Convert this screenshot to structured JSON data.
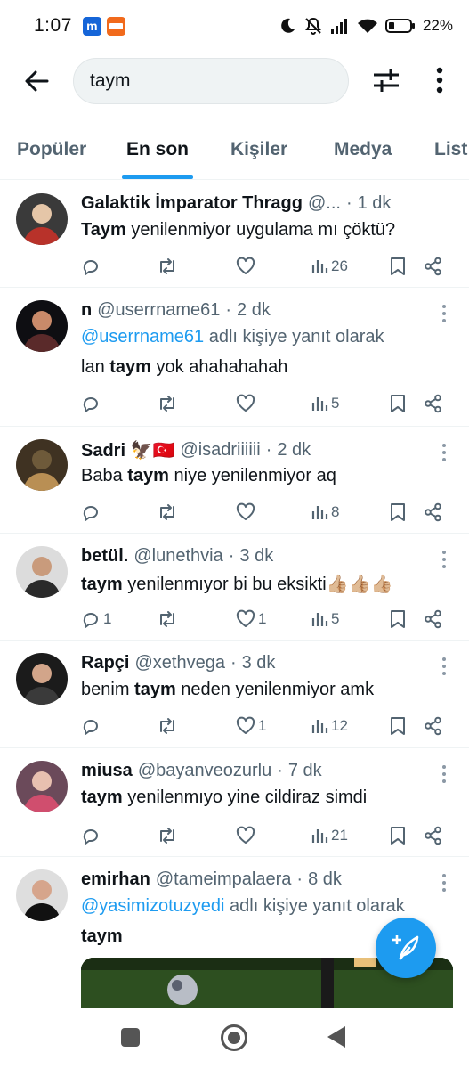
{
  "status_bar": {
    "time": "1:07",
    "app_icon_1": "m",
    "battery_percent": "22%"
  },
  "search": {
    "query": "taym"
  },
  "tabs": [
    {
      "label": "Popüler",
      "active": false
    },
    {
      "label": "En son",
      "active": true
    },
    {
      "label": "Kişiler",
      "active": false
    },
    {
      "label": "Medya",
      "active": false
    },
    {
      "label": "List",
      "active": false
    }
  ],
  "tweets": [
    {
      "name": "Galaktik İmparator Thragg",
      "handle": "@...",
      "dot": "·",
      "time": "1 dk",
      "reply_prefix": "",
      "reply_mention": "",
      "reply_suffix": "",
      "text_before": "",
      "text_bold": "Taym",
      "text_after": " yenilenmiyor uygulama mı çöktü?",
      "text_bold_2": "",
      "replies": "",
      "retweets": "",
      "likes": "",
      "views": "26"
    },
    {
      "name": "n",
      "handle": "@userrname61",
      "dot": "·",
      "time": "2 dk",
      "reply_prefix": "",
      "reply_mention": "@userrname61",
      "reply_suffix": " adlı kişiye yanıt olarak",
      "text_before": "lan ",
      "text_bold": "taym",
      "text_after": " yok ahahahahah",
      "text_bold_2": "",
      "replies": "",
      "retweets": "",
      "likes": "",
      "views": "5"
    },
    {
      "name": "Sadri 🦅🇹🇷",
      "handle": "@isadriiiiii",
      "dot": "·",
      "time": "2 dk",
      "reply_prefix": "",
      "reply_mention": "",
      "reply_suffix": "",
      "text_before": "Baba ",
      "text_bold": "taym",
      "text_after": " niye yenilenmiyor aq",
      "text_bold_2": "",
      "replies": "",
      "retweets": "",
      "likes": "",
      "views": "8"
    },
    {
      "name": "betül.",
      "handle": "@lunethvia",
      "dot": "·",
      "time": "3 dk",
      "reply_prefix": "",
      "reply_mention": "",
      "reply_suffix": "",
      "text_before": "",
      "text_bold": "taym",
      "text_after": " yenilenmıyor bi bu eksikti👍🏼👍🏼👍🏼",
      "text_bold_2": "",
      "replies": "1",
      "retweets": "",
      "likes": "1",
      "views": "5"
    },
    {
      "name": "Rapçi",
      "handle": "@xethvega",
      "dot": "·",
      "time": "3 dk",
      "reply_prefix": "",
      "reply_mention": "",
      "reply_suffix": "",
      "text_before": "benim ",
      "text_bold": "taym",
      "text_after": " neden yenilenmiyor amk",
      "text_bold_2": "",
      "replies": "",
      "retweets": "",
      "likes": "1",
      "views": "12"
    },
    {
      "name": "miusa",
      "handle": "@bayanveozurlu",
      "dot": "·",
      "time": "7 dk",
      "reply_prefix": "",
      "reply_mention": "",
      "reply_suffix": "",
      "text_before": "",
      "text_bold": "taym",
      "text_after": " yenilenmıyo yine cildiraz simdi",
      "text_bold_2": "",
      "replies": "",
      "retweets": "",
      "likes": "",
      "views": "21"
    },
    {
      "name": "emirhan",
      "handle": "@tameimpalaera",
      "dot": "·",
      "time": "8 dk",
      "reply_prefix": "",
      "reply_mention": "@yasimizotuzyedi",
      "reply_suffix": " adlı kişiye yanıt olarak",
      "text_before": "",
      "text_bold": "taym",
      "text_after": "",
      "text_bold_2": "",
      "replies": "",
      "retweets": "",
      "likes": "",
      "views": ""
    }
  ],
  "colors": {
    "accent": "#1d9bf0",
    "text_primary": "#0f1419",
    "text_secondary": "#536471"
  },
  "icons": {
    "back": "arrow-left-icon",
    "filter": "sliders-icon",
    "more": "more-vertical-icon",
    "reply": "reply-icon",
    "retweet": "retweet-icon",
    "like": "heart-icon",
    "views": "bar-chart-icon",
    "bookmark": "bookmark-icon",
    "share": "share-icon",
    "compose": "compose-icon"
  }
}
